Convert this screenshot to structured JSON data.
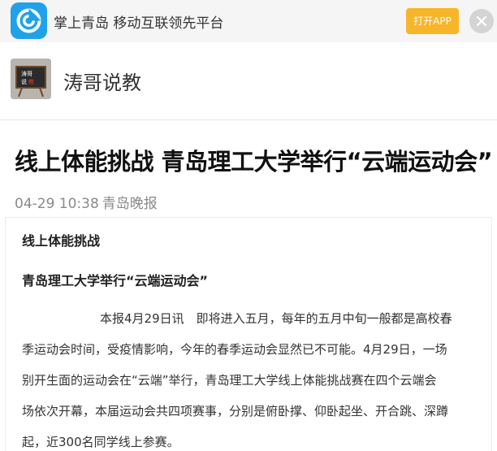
{
  "appbar": {
    "title": "掌上青岛 移动互联领先平台",
    "open_button": "打开APP",
    "logo_icon": "swirl-logo-icon",
    "close_icon": "close-icon"
  },
  "author": {
    "name": "涛哥说教",
    "avatar_text_1": "涛哥",
    "avatar_text_2": "说",
    "avatar_text_3": "教"
  },
  "article": {
    "title": "线上体能挑战 青岛理工大学举行“云端运动会”",
    "date": "04-29 10:38",
    "source": "青岛晚报",
    "subheading_1": "线上体能挑战",
    "subheading_2": "青岛理工大学举行“云端运动会”",
    "paragraph_lines": [
      "本报4月29日讯　即将进入五月，每年的五月中旬一般都是高校春",
      "季运动会时间，受疫情影响，今年的春季运动会显然已不可能。4月29日，一场",
      "别开生面的运动会在“云端”举行，青岛理工大学线上体能挑战赛在四个云端会",
      "场依次开幕，本届运动会共四项赛事，分别是俯卧撑、仰卧起坐、开合跳、深蹲",
      "起，近300名同学线上参赛。"
    ]
  },
  "colors": {
    "accent_orange": "#f7b52a",
    "logo_blue": "#1fa2ea",
    "meta_gray": "#8a8a8a"
  }
}
